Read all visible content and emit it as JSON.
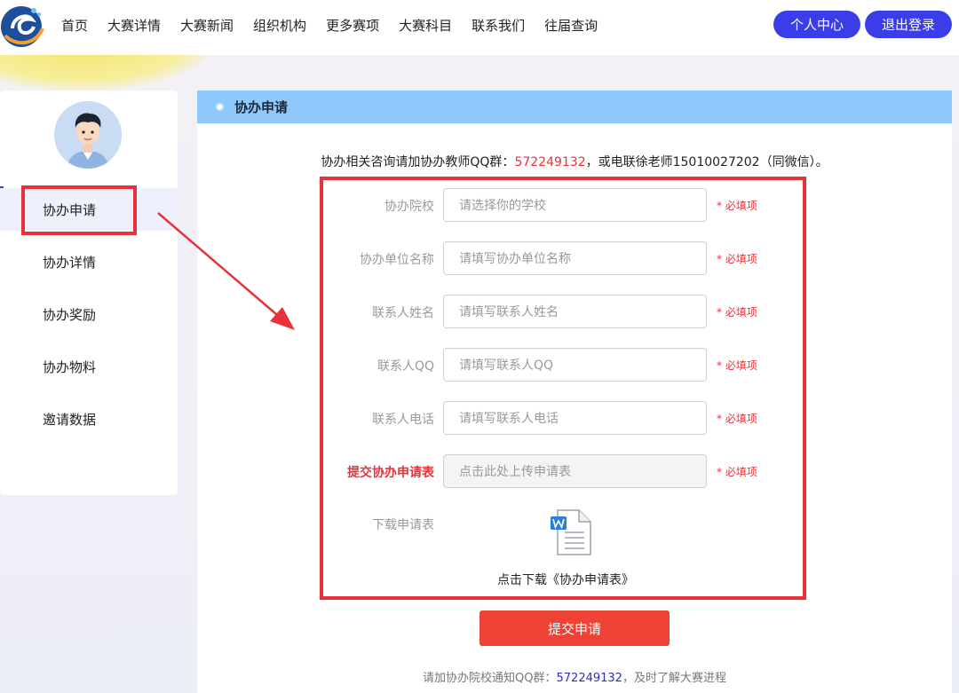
{
  "nav": {
    "items": [
      "首页",
      "大赛详情",
      "大赛新闻",
      "组织机构",
      "更多赛项",
      "大赛科目",
      "联系我们",
      "往届查询"
    ],
    "profile_btn": "个人中心",
    "logout_btn": "退出登录"
  },
  "sidebar": {
    "items": [
      "协办申请",
      "协办详情",
      "协办奖励",
      "协办物料",
      "邀请数据"
    ],
    "active": "协办申请"
  },
  "panel": {
    "title": "协办申请",
    "notice_prefix": "协办相关咨询请加协办教师QQ群：",
    "notice_qq": "572249132",
    "notice_suffix": "，或电联徐老师15010027202（同微信）。"
  },
  "form": {
    "fields": [
      {
        "label": "协办院校",
        "placeholder": "请选择你的学校",
        "required": "* 必填项"
      },
      {
        "label": "协办单位名称",
        "placeholder": "请填写协办单位名称",
        "required": "* 必填项"
      },
      {
        "label": "联系人姓名",
        "placeholder": "请填写联系人姓名",
        "required": "* 必填项"
      },
      {
        "label": "联系人QQ",
        "placeholder": "请填写联系人QQ",
        "required": "* 必填项"
      },
      {
        "label": "联系人电话",
        "placeholder": "请填写联系人电话",
        "required": "* 必填项"
      },
      {
        "label": "提交协办申请表",
        "placeholder": "点击此处上传申请表",
        "required": "* 必填项"
      }
    ],
    "download_label": "下载申请表",
    "download_link": "点击下载《协办申请表》",
    "submit": "提交申请"
  },
  "footer": {
    "prefix": "请加协办院校通知QQ群：",
    "qq": "572249132",
    "suffix": "，及时了解大赛进程"
  },
  "colors": {
    "accent": "#3b3ee8",
    "highlight": "#e8323a",
    "panel_head": "#8fc8fb",
    "submit": "#ee4236"
  },
  "icons": {
    "doc": "word-document-icon"
  }
}
